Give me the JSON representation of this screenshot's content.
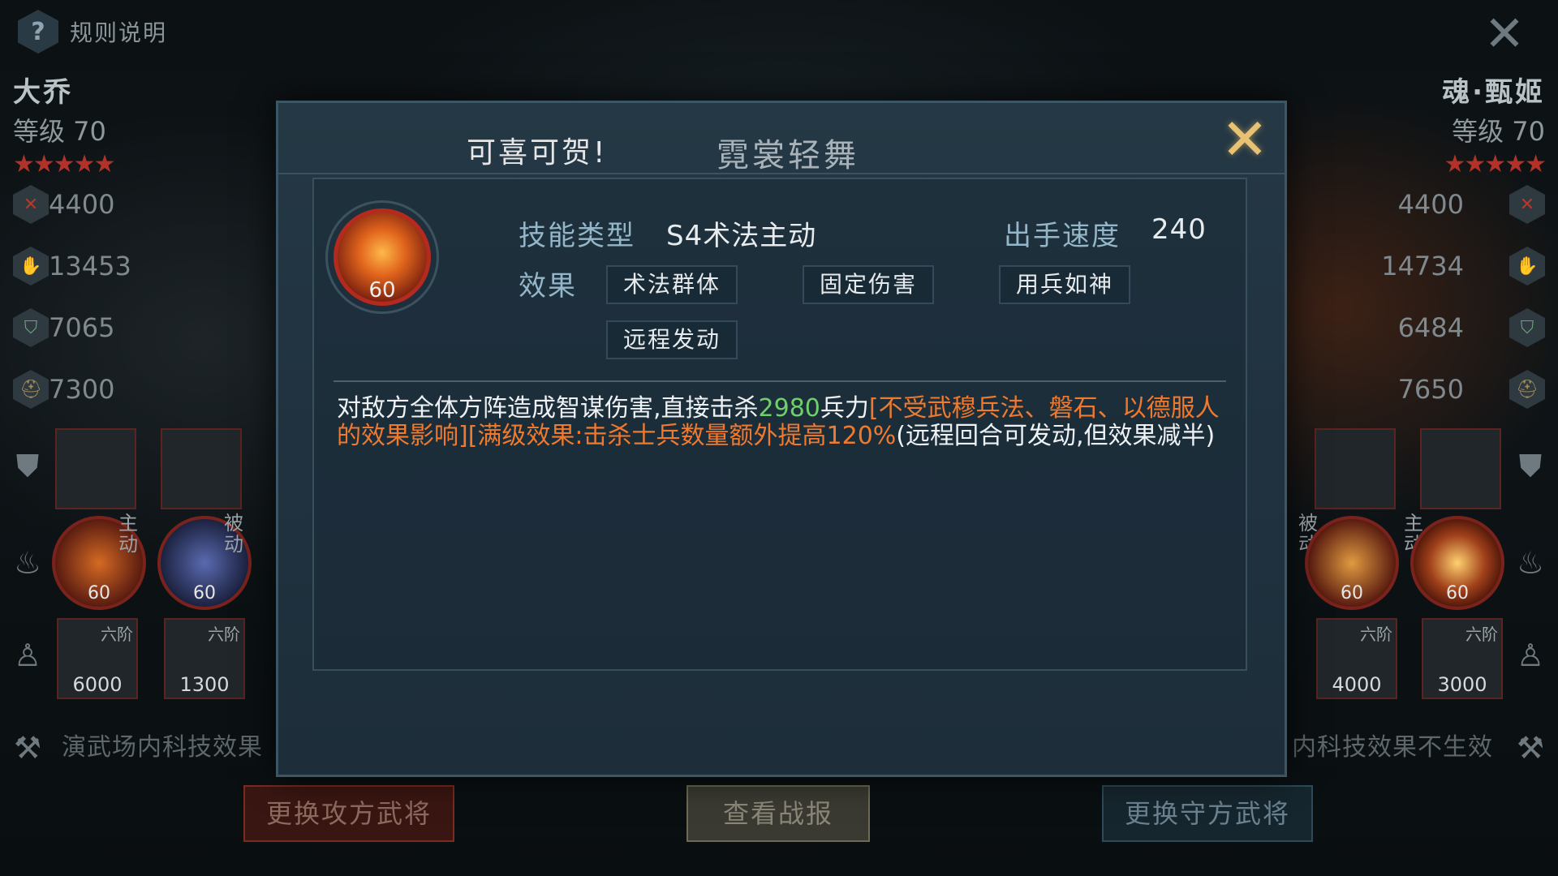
{
  "rules": {
    "icon": "question-icon",
    "label": "规则说明"
  },
  "attacker": {
    "name": "大乔",
    "level": "等级 70",
    "stars": "★★★★★",
    "stats": [
      "4400",
      "13453",
      "7065",
      "7300"
    ],
    "skills": [
      {
        "type": "主动",
        "level": "60"
      },
      {
        "type": "被动",
        "level": "60"
      }
    ],
    "troops": [
      {
        "rank": "六阶",
        "count": "6000"
      },
      {
        "rank": "六阶",
        "count": "1300"
      }
    ]
  },
  "defender": {
    "name": "魂·甄姬",
    "level": "等级 70",
    "stars": "★★★★★",
    "stats": [
      "4400",
      "14734",
      "6484",
      "7650"
    ],
    "skills": [
      {
        "type": "被动",
        "level": "60"
      },
      {
        "type": "主动",
        "level": "60"
      }
    ],
    "troops": [
      {
        "rank": "六阶",
        "count": "4000"
      },
      {
        "rank": "六阶",
        "count": "3000"
      }
    ]
  },
  "tech_note_left": "演武场内科技效果",
  "tech_note_right": "内科技效果不生效",
  "buttons": {
    "attack": "更换攻方武将",
    "report": "查看战报",
    "defend": "更换守方武将"
  },
  "modal": {
    "congrats": "可喜可贺!",
    "skill_name": "霓裳轻舞",
    "skill_level": "60",
    "type_label": "技能类型",
    "type_value": "S4术法主动",
    "speed_label": "出手速度",
    "speed_value": "240",
    "effect_label": "效果",
    "tags": [
      "术法群体",
      "固定伤害",
      "用兵如神",
      "远程发动"
    ],
    "desc": {
      "part1": "对敌方全体方阵造成智谋伤害,直接击杀",
      "number": "2980",
      "part2": "兵力",
      "orange": "[不受武穆兵法、磐石、以德服人的效果影响][满级效果:击杀士兵数量额外提高120%",
      "part3": "(远程回合可发动,但效果减半)"
    }
  },
  "colors": {
    "accent_gold": "#e8c272",
    "number_green": "#6fd06a",
    "highlight_orange": "#ef7a2e",
    "star_red": "#b2322a"
  }
}
